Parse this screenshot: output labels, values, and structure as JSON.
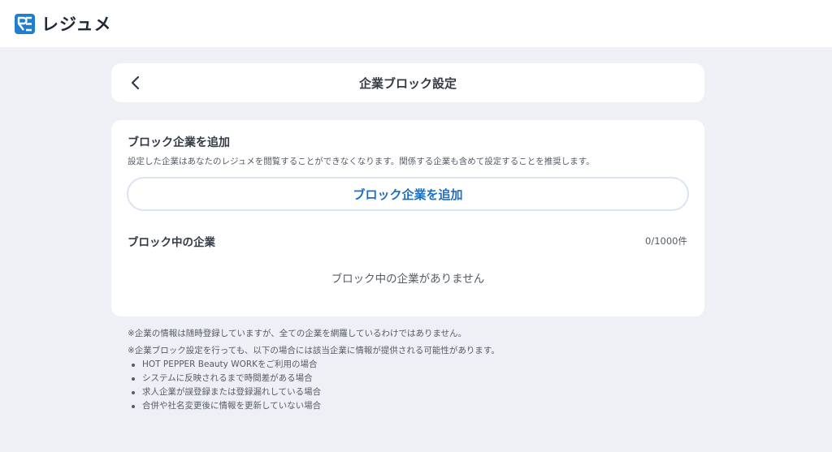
{
  "header": {
    "logo_text": "レジュメ",
    "logo_icon": "resume-logo-icon"
  },
  "title_card": {
    "back_icon": "chevron-left-icon",
    "title": "企業ブロック設定"
  },
  "main": {
    "add_section_heading": "ブロック企業を追加",
    "add_section_description": "設定した企業はあなたのレジュメを閲覧することができなくなります。関係する企業も含めて設定することを推奨します。",
    "add_button_label": "ブロック企業を追加",
    "blocked_heading": "ブロック中の企業",
    "blocked_count": "0/1000件",
    "empty_message": "ブロック中の企業がありません"
  },
  "notes": {
    "note1": "※企業の情報は随時登録していますが、全ての企業を網羅しているわけではありません。",
    "note2": "※企業ブロック設定を行っても、以下の場合には該当企業に情報が提供される可能性があります。",
    "items": [
      "HOT PEPPER Beauty WORKをご利用の場合",
      "システムに反映されるまで時間差がある場合",
      "求人企業が誤登録または登録漏れしている場合",
      "合併や社名変更後に情報を更新していない場合"
    ]
  },
  "colors": {
    "background": "#eef0f5",
    "card": "#ffffff",
    "accent": "#1a6fc4",
    "logo": "#1e7fd0",
    "text": "#333a44"
  }
}
